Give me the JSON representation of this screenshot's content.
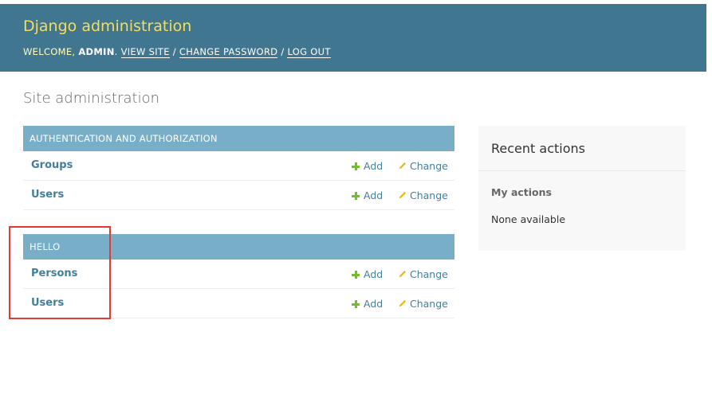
{
  "header": {
    "branding": "Django administration",
    "welcome": "WELCOME,",
    "username": "ADMIN",
    "links": {
      "view_site": "VIEW SITE",
      "change_password": "CHANGE PASSWORD",
      "log_out": "LOG OUT"
    },
    "separator": "/",
    "color": "#417690",
    "branding_color": "#f5dd5d"
  },
  "page_title": "Site administration",
  "modules": [
    {
      "caption": "AUTHENTICATION AND AUTHORIZATION",
      "rows": [
        {
          "name": "Groups",
          "add": "Add",
          "change": "Change"
        },
        {
          "name": "Users",
          "add": "Add",
          "change": "Change"
        }
      ]
    },
    {
      "caption": "HELLO",
      "rows": [
        {
          "name": "Persons",
          "add": "Add",
          "change": "Change"
        },
        {
          "name": "Users",
          "add": "Add",
          "change": "Change"
        }
      ]
    }
  ],
  "recent_actions": {
    "title": "Recent actions",
    "my_actions": "My actions",
    "none": "None available"
  },
  "icons": {
    "add": "plus-icon",
    "change": "pencil-icon"
  },
  "colors": {
    "module_caption": "#79aec8",
    "link": "#447e9b",
    "add_icon": "#70bf2b",
    "change_icon": "#efb80b",
    "highlight": "#e53935"
  }
}
